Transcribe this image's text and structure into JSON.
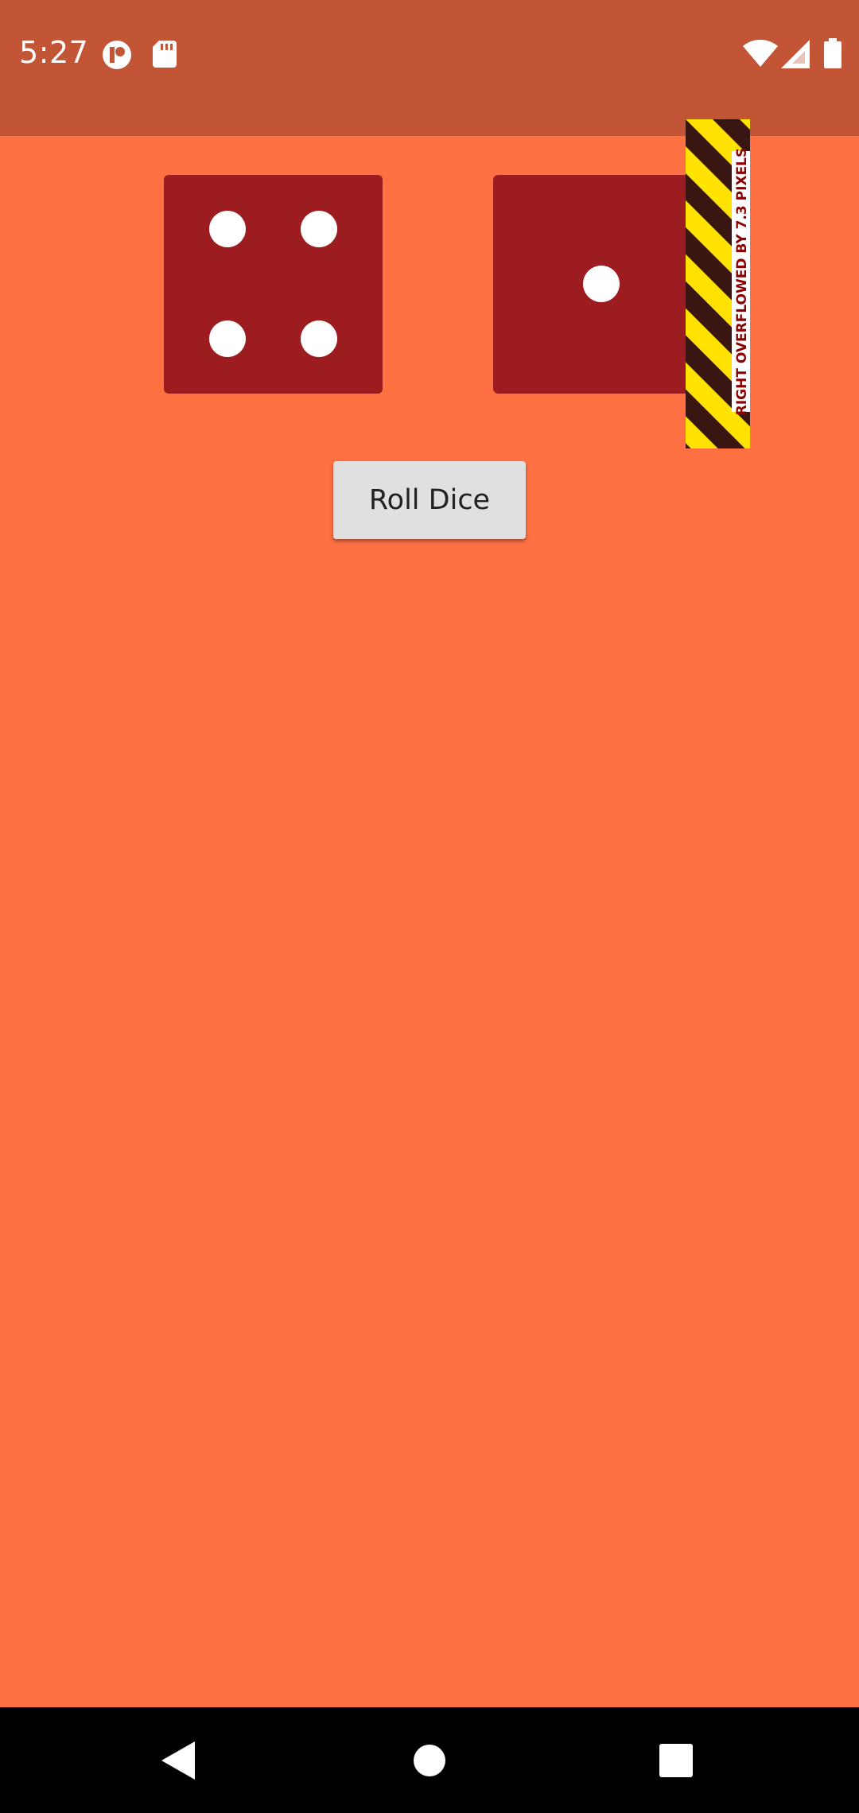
{
  "status_bar": {
    "time": "5:27",
    "background": "#C15535",
    "left_icons": [
      "notification-app-icon",
      "sd-card-icon"
    ],
    "right_icons": [
      "wifi-icon",
      "cellular-signal-icon",
      "battery-icon"
    ]
  },
  "app": {
    "background": "#FF7043",
    "dice": [
      {
        "value": 4,
        "color": "#9C1C1F",
        "pip_color": "#FFFFFF"
      },
      {
        "value": 1,
        "color": "#9C1C1F",
        "pip_color": "#FFFFFF"
      }
    ],
    "overflow_warning": "RIGHT OVERFLOWED BY 7.3 PIXELS",
    "roll_button_label": "Roll Dice"
  },
  "nav_bar": {
    "background": "#000000",
    "buttons": [
      "back-icon",
      "home-icon",
      "recents-icon"
    ]
  }
}
